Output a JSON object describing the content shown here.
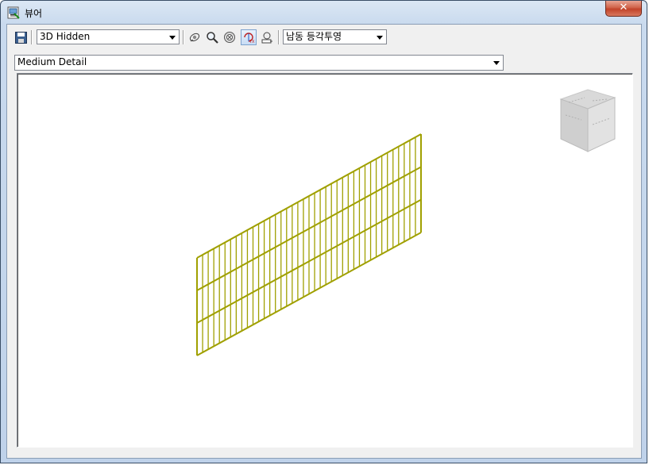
{
  "window": {
    "title": "뷰어",
    "close_glyph": "✕"
  },
  "toolbar": {
    "save_icon": "floppy-disk-icon",
    "visual_style": {
      "value": "3D Hidden"
    },
    "tools": [
      "orbit-icon",
      "zoom-icon",
      "zoom-extents-icon",
      "rotate-xy-icon",
      "pan-icon"
    ],
    "view_direction": {
      "value": "남동 등각투영"
    }
  },
  "detail_level": {
    "value": "Medium Detail"
  },
  "viewport": {
    "model_color": "#a0a000",
    "background": "#ffffff",
    "view_cube": "view-cube-icon"
  },
  "colors": {
    "accent_close": "#c2432a",
    "frame": "#bfd2ea"
  }
}
